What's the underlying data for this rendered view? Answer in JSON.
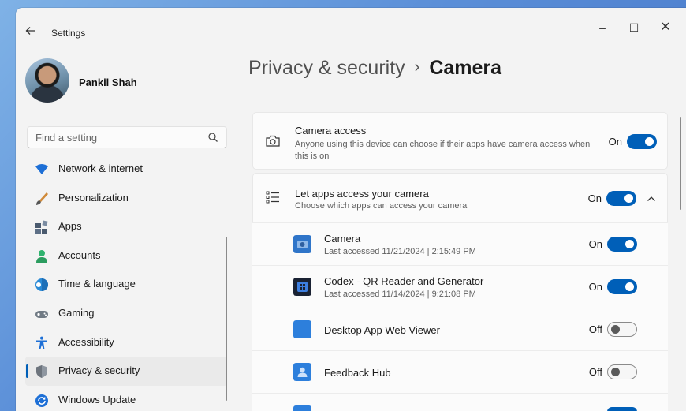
{
  "window": {
    "app_title": "Settings",
    "controls": {
      "minimize": "–",
      "maximize": "☐",
      "close": "✕"
    }
  },
  "profile": {
    "name": "Pankil Shah"
  },
  "search": {
    "placeholder": "Find a setting"
  },
  "sidebar": {
    "items": [
      {
        "label": "Network & internet",
        "icon": "wifi-icon",
        "selected": false
      },
      {
        "label": "Personalization",
        "icon": "brush-icon",
        "selected": false
      },
      {
        "label": "Apps",
        "icon": "apps-icon",
        "selected": false
      },
      {
        "label": "Accounts",
        "icon": "person-icon",
        "selected": false
      },
      {
        "label": "Time & language",
        "icon": "globe-clock-icon",
        "selected": false
      },
      {
        "label": "Gaming",
        "icon": "gamepad-icon",
        "selected": false
      },
      {
        "label": "Accessibility",
        "icon": "accessibility-icon",
        "selected": false
      },
      {
        "label": "Privacy & security",
        "icon": "shield-icon",
        "selected": true
      },
      {
        "label": "Windows Update",
        "icon": "update-icon",
        "selected": false
      }
    ]
  },
  "breadcrumb": {
    "parent": "Privacy & security",
    "separator": "›",
    "current": "Camera"
  },
  "camera_access": {
    "title": "Camera access",
    "description": "Anyone using this device can choose if their apps have camera access when this is on",
    "state_label": "On",
    "enabled": true
  },
  "apps_access": {
    "title": "Let apps access your camera",
    "description": "Choose which apps can access your camera",
    "state_label": "On",
    "enabled": true,
    "expanded": true
  },
  "apps": [
    {
      "name": "Camera",
      "last_accessed": "Last accessed 11/21/2024  |  2:15:49 PM",
      "state_label": "On",
      "enabled": true,
      "icon": "camera-app-icon"
    },
    {
      "name": "Codex - QR Reader and Generator",
      "last_accessed": "Last accessed 11/14/2024  |  9:21:08 PM",
      "state_label": "On",
      "enabled": true,
      "icon": "qr-app-icon"
    },
    {
      "name": "Desktop App Web Viewer",
      "last_accessed": "",
      "state_label": "Off",
      "enabled": false,
      "icon": "web-viewer-app-icon"
    },
    {
      "name": "Feedback Hub",
      "last_accessed": "",
      "state_label": "Off",
      "enabled": false,
      "icon": "feedback-hub-app-icon"
    }
  ],
  "colors": {
    "accent": "#005fb8",
    "window_bg": "#f3f3f3",
    "card_bg": "#fbfbfb"
  }
}
